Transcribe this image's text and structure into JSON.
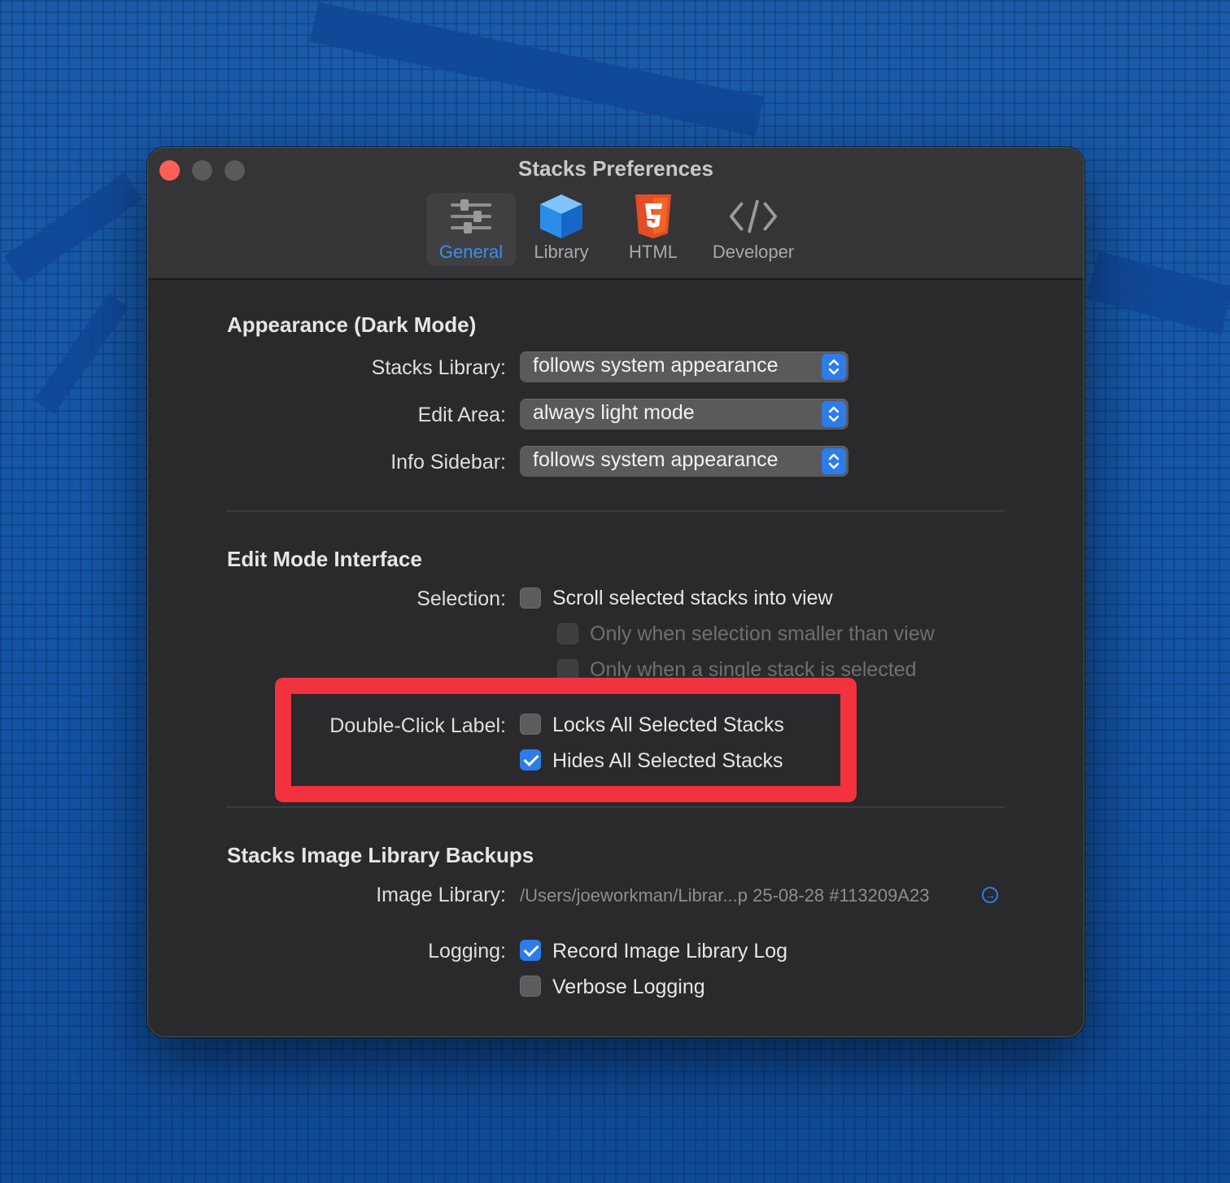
{
  "window": {
    "title": "Stacks Preferences"
  },
  "toolbar": {
    "items": [
      {
        "label": "General",
        "icon": "sliders-icon",
        "active": true
      },
      {
        "label": "Library",
        "icon": "cube-icon",
        "active": false
      },
      {
        "label": "HTML",
        "icon": "html5-icon",
        "active": false
      },
      {
        "label": "Developer",
        "icon": "code-icon",
        "active": false
      }
    ]
  },
  "appearance": {
    "heading": "Appearance (Dark Mode)",
    "stacks_library": {
      "label": "Stacks Library:",
      "value": "follows system appearance"
    },
    "edit_area": {
      "label": "Edit Area:",
      "value": "always light mode"
    },
    "info_sidebar": {
      "label": "Info Sidebar:",
      "value": "follows system appearance"
    }
  },
  "edit_mode": {
    "heading": "Edit Mode Interface",
    "selection_label": "Selection:",
    "scroll_into_view": {
      "label": "Scroll selected stacks into view",
      "checked": false
    },
    "only_smaller": {
      "label": "Only when selection smaller than view",
      "checked": false,
      "disabled": true
    },
    "only_single": {
      "label": "Only when a single stack is selected",
      "checked": false,
      "disabled": true
    },
    "double_click_label": "Double-Click Label:",
    "locks_all": {
      "label": "Locks All Selected Stacks",
      "checked": false
    },
    "hides_all": {
      "label": "Hides All Selected Stacks",
      "checked": true
    }
  },
  "backups": {
    "heading": "Stacks Image Library Backups",
    "image_library_label": "Image Library:",
    "image_library_path": "/Users/joeworkman/Librar...p 25-08-28 #113209A23",
    "logging_label": "Logging:",
    "record_log": {
      "label": "Record Image Library Log",
      "checked": true
    },
    "verbose": {
      "label": "Verbose Logging",
      "checked": false
    }
  },
  "colors": {
    "accent": "#2e7bea",
    "highlight": "#f2323e",
    "close_button": "#fe5f57"
  }
}
